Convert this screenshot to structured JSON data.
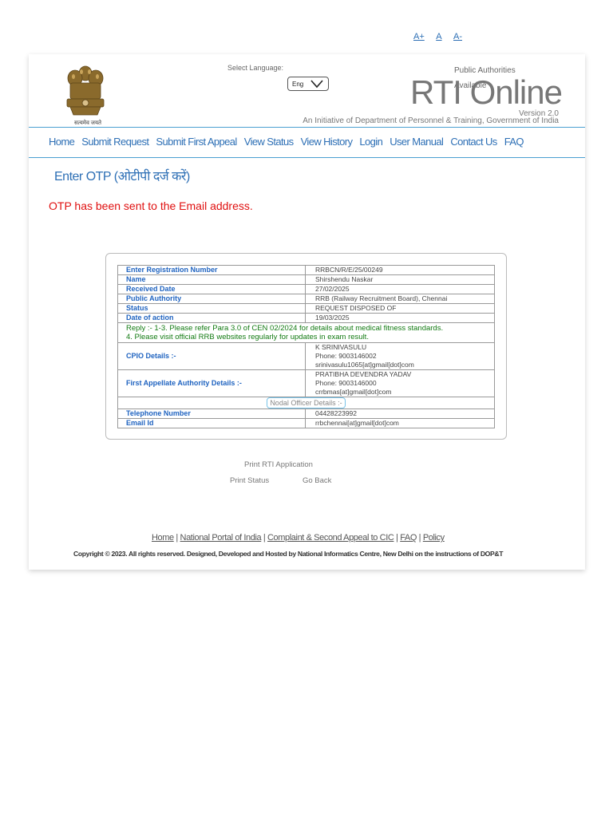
{
  "font_size": {
    "increase": "A+",
    "normal": "A",
    "decrease": "A-"
  },
  "header": {
    "emblem_motto": "सत्यमेव जयते",
    "select_language_label": "Select Language:",
    "language": "Eng",
    "public_authorities_line1": "Public Authorities",
    "public_authorities_line2": "Available",
    "title": "RTI Online",
    "version": "Version 2.0",
    "initiative": "An Initiative of Department of Personnel & Training, Government of India"
  },
  "nav": [
    "Home",
    "Submit Request",
    "Submit First Appeal",
    "View Status",
    "View History",
    "Login",
    "User Manual",
    "Contact Us",
    "FAQ"
  ],
  "page_heading": "Enter OTP (ओटीपी दर्ज करें)",
  "otp_message": "OTP has been sent to the Email address.",
  "details": {
    "registration_label": "Enter Registration Number",
    "registration_value": "RRBCN/R/E/25/00249",
    "name_label": "Name",
    "name_value": "Shirshendu Naskar",
    "received_label": "Received Date",
    "received_value": "27/02/2025",
    "authority_label": "Public Authority",
    "authority_value": "RRB (Railway Recruitment Board), Chennai",
    "status_label": "Status",
    "status_value": "REQUEST DISPOSED OF",
    "action_label": "Date of action",
    "action_value": "19/03/2025",
    "reply_line1": "Reply :- 1-3. Please refer Para 3.0 of CEN 02/2024 for details about medical fitness standards.",
    "reply_line2": "4. Please visit official RRB websites regularly for updates in exam result.",
    "cpio_label": "CPIO Details :-",
    "cpio_name": "K SRINIVASULU",
    "cpio_phone": "Phone: 9003146002",
    "cpio_email": "srinivasulu1065[at]gmail[dot]com",
    "faa_label": "First Appellate Authority Details :-",
    "faa_name": "PRATIBHA DEVENDRA YADAV",
    "faa_phone": "Phone: 9003146000",
    "faa_email": "crrbmas[at]gmail[dot]com",
    "nodal_label": "Nodal Officer Details :-",
    "telephone_label": "Telephone Number",
    "telephone_value": "04428223992",
    "email_label": "Email Id",
    "email_value": "rrbchennai[at]gmail[dot]com"
  },
  "actions": {
    "print_application": "Print RTI Application",
    "print_status": "Print Status",
    "go_back": "Go Back"
  },
  "footer": {
    "links": [
      "Home",
      "National Portal of India",
      "Complaint & Second Appeal to CIC",
      "FAQ",
      "Policy"
    ],
    "separator": " | ",
    "copyright": "Copyright © 2023. All rights reserved. Designed, Developed and Hosted by National Informatics Centre, New Delhi on the instructions of DOP&T"
  },
  "colors": {
    "link_blue": "#2d6fb5",
    "label_blue": "#1f63c0",
    "error_red": "#e01010",
    "reply_green": "#137b13",
    "divider_blue": "#4a9fd1"
  }
}
